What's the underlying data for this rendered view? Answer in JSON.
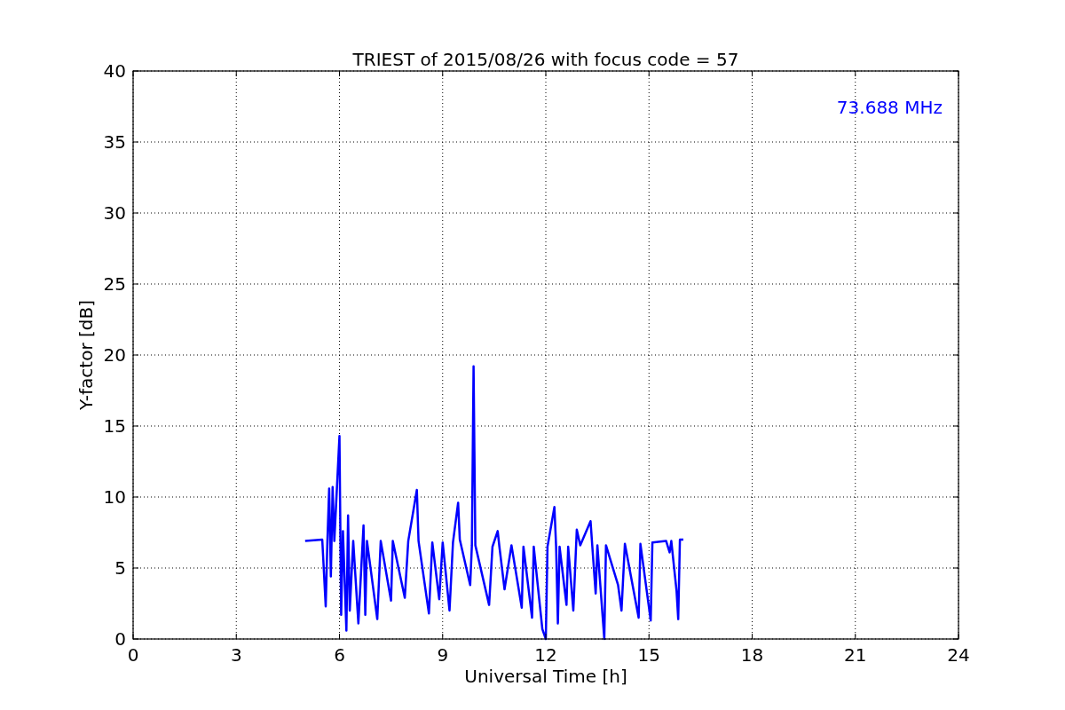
{
  "figure": {
    "chart_data": {
      "type": "line",
      "title": "TRIEST of 2015/08/26 with focus code = 57",
      "xlabel": "Universal Time [h]",
      "ylabel": "Y-factor [dB]",
      "xlim": [
        0,
        24
      ],
      "ylim": [
        0,
        40
      ],
      "xticks": [
        0,
        3,
        6,
        9,
        12,
        15,
        18,
        21,
        24
      ],
      "yticks": [
        0,
        5,
        10,
        15,
        20,
        25,
        30,
        35,
        40
      ],
      "grid": true,
      "series": [
        {
          "name": "73.688 MHz",
          "color": "#0000ff",
          "x": [
            5.0,
            5.5,
            5.6,
            5.65,
            5.7,
            5.75,
            5.8,
            5.85,
            6.0,
            6.05,
            6.1,
            6.2,
            6.25,
            6.3,
            6.4,
            6.55,
            6.7,
            6.75,
            6.8,
            7.1,
            7.2,
            7.5,
            7.55,
            7.9,
            8.0,
            8.25,
            8.3,
            8.6,
            8.7,
            8.9,
            9.0,
            9.2,
            9.3,
            9.45,
            9.5,
            9.8,
            9.85,
            9.9,
            9.95,
            10.35,
            10.45,
            10.6,
            10.65,
            10.8,
            11.0,
            11.3,
            11.35,
            11.6,
            11.65,
            11.9,
            12.0,
            12.05,
            12.25,
            12.3,
            12.35,
            12.4,
            12.6,
            12.65,
            12.8,
            12.9,
            13.0,
            13.3,
            13.35,
            13.45,
            13.5,
            13.7,
            13.75,
            14.1,
            14.2,
            14.3,
            14.7,
            14.75,
            15.05,
            15.1,
            15.5,
            15.6,
            15.65,
            15.8,
            15.85,
            15.9,
            16.0
          ],
          "values": [
            6.9,
            7.0,
            2.3,
            6.9,
            10.6,
            4.4,
            10.7,
            6.9,
            14.3,
            1.7,
            7.6,
            0.6,
            8.7,
            2.0,
            6.9,
            1.1,
            8.0,
            1.7,
            6.9,
            1.4,
            6.9,
            2.7,
            6.9,
            2.9,
            6.9,
            10.5,
            6.9,
            1.8,
            6.8,
            2.8,
            6.8,
            2.0,
            6.8,
            9.6,
            7.0,
            3.8,
            6.6,
            19.2,
            6.6,
            2.4,
            6.5,
            7.6,
            6.5,
            3.5,
            6.6,
            2.2,
            6.5,
            1.5,
            6.5,
            0.7,
            0.0,
            6.5,
            9.3,
            6.5,
            1.1,
            6.5,
            2.4,
            6.5,
            2.0,
            7.7,
            6.6,
            8.3,
            6.6,
            3.2,
            6.6,
            0.0,
            6.6,
            3.8,
            2.0,
            6.7,
            1.5,
            6.7,
            1.3,
            6.8,
            6.9,
            6.1,
            6.9,
            3.4,
            1.4,
            7.0,
            7.0
          ]
        }
      ]
    }
  }
}
